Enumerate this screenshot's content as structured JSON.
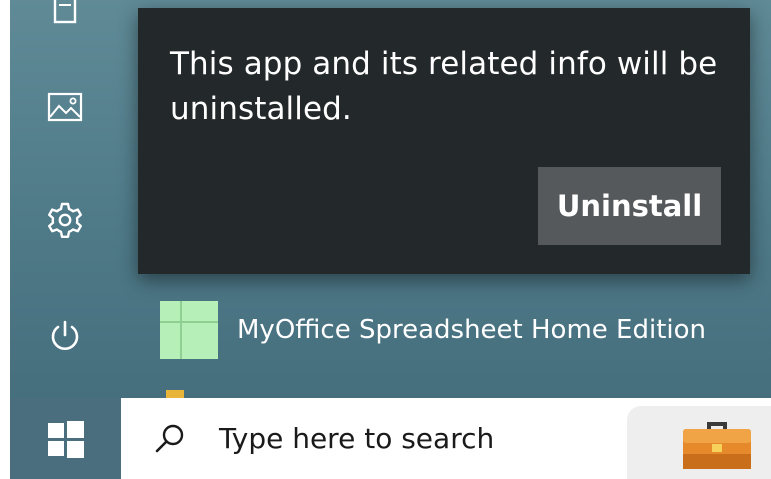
{
  "flyout": {
    "message_line1": "This app and its related info will be",
    "message_line2": "uninstalled.",
    "uninstall_label": "Uninstall"
  },
  "start_menu": {
    "rail_icons": [
      "document-icon",
      "pictures-icon",
      "settings-gear-icon",
      "power-icon"
    ],
    "app_list": [
      {
        "label": "MyOffice Spreadsheet Home Edition",
        "icon": "spreadsheet-app-icon"
      }
    ]
  },
  "taskbar": {
    "start_icon": "windows-logo-icon",
    "search": {
      "icon": "search-icon",
      "placeholder": "Type here to search"
    },
    "pinned": [
      "toolbox-icon"
    ]
  },
  "colors": {
    "start_menu_bg": "#5f8a96",
    "flyout_bg": "#23282b",
    "uninstall_button_bg": "#55595c",
    "app_icon_bg": "#b6efb8",
    "start_button_bg": "#4a6e7d",
    "toolbox_orange": "#e5892a"
  }
}
